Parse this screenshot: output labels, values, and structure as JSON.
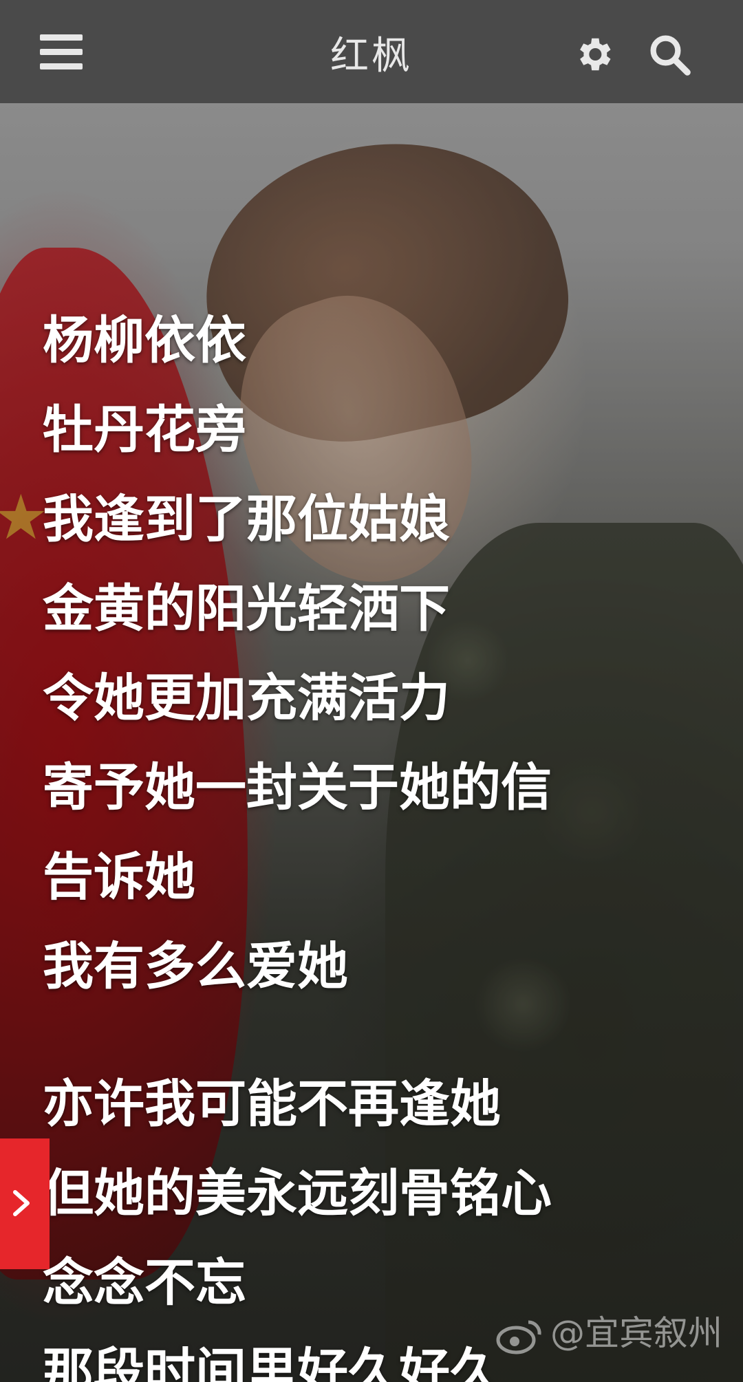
{
  "header": {
    "title": "红枫",
    "menu_icon": "menu-icon",
    "settings_icon": "gear-icon",
    "search_icon": "search-icon"
  },
  "lyrics": {
    "stanza1": [
      "杨柳依依",
      "牡丹花旁",
      "我逢到了那位姑娘",
      "金黄的阳光轻洒下",
      "令她更加充满活力",
      "寄予她一封关于她的信",
      "告诉她",
      "我有多么爱她"
    ],
    "stanza2": [
      "亦许我可能不再逢她",
      "但她的美永远刻骨铭心",
      "念念不忘",
      "那段时间里好久好久"
    ]
  },
  "watermark": "@宜宾叙州",
  "side_tab": {
    "icon": "chevron-right-icon"
  },
  "colors": {
    "topbar": "#4a4a4a",
    "accent_tab": "#e6262b",
    "text": "#ffffff"
  }
}
